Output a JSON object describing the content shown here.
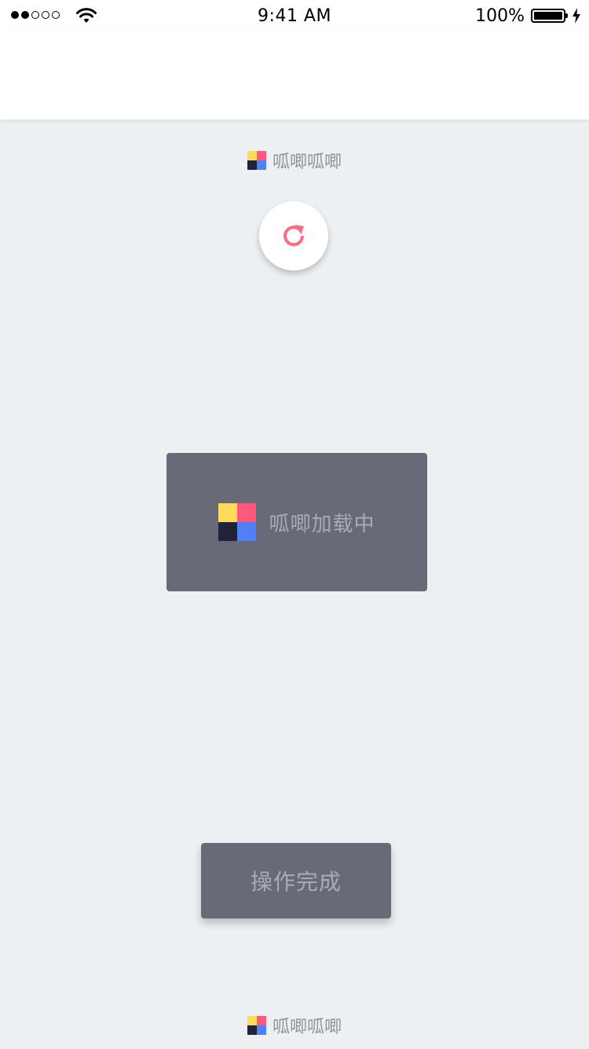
{
  "status_bar": {
    "signal_bars_filled": 2,
    "signal_bars_total": 5,
    "time": "9:41 AM",
    "battery_percent": "100%",
    "icons": [
      "wifi-icon",
      "battery-icon",
      "charging-bolt-icon"
    ]
  },
  "brand": {
    "name": "呱唧呱唧",
    "logo_colors": [
      "#fedc5a",
      "#ff587b",
      "#22223a",
      "#4f80f5"
    ]
  },
  "refresh": {
    "icon": "refresh-icon",
    "color": "#ff6b81"
  },
  "loading_toast": {
    "text": "呱唧加载中",
    "background": "#686a78"
  },
  "done_button": {
    "label": "操作完成",
    "background": "#686a78"
  },
  "footer_brand": {
    "name": "呱唧呱唧"
  }
}
